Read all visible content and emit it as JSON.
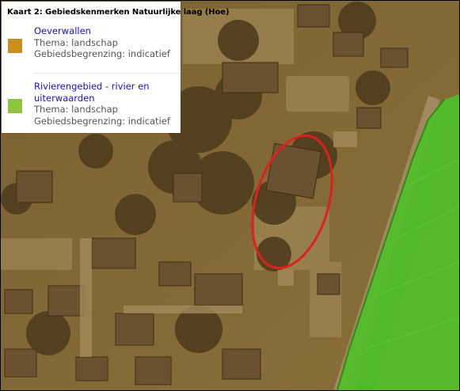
{
  "legend": {
    "title": "Kaart 2: Gebiedskenmerken Natuurlijke laag (Hoe)",
    "entries": [
      {
        "name": "Oeverwallen",
        "thema": "Thema: landschap",
        "begrenzing": "Gebiedsbegrenzing: indicatief",
        "color": "#c8901a"
      },
      {
        "name_line1": "Rivierengebied - rivier en",
        "name_line2": "uiterwaarden",
        "thema": "Thema: landschap",
        "begrenzing": "Gebiedsbegrenzing: indicatief",
        "color": "#8cc63f"
      }
    ]
  },
  "map": {
    "tint_color": "#b8893f",
    "overlay_color": "#4fc02a",
    "highlight_color": "#e0201c"
  }
}
